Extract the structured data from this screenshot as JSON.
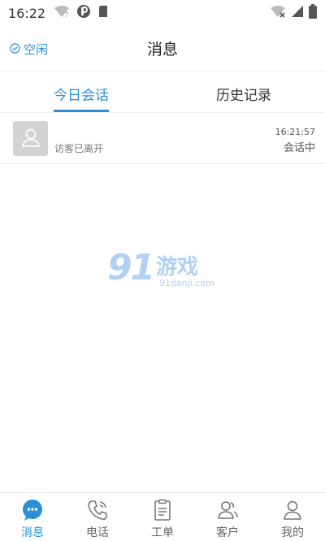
{
  "status_bar": {
    "time": "16:22"
  },
  "header": {
    "status_label": "空闲",
    "title": "消息"
  },
  "tabs": [
    {
      "label": "今日会话"
    },
    {
      "label": "历史记录"
    }
  ],
  "sessions": [
    {
      "message": "访客已离开",
      "time": "16:21:57",
      "state": "会话中"
    }
  ],
  "watermark": {
    "number": "91",
    "brand": "游戏",
    "url": "91danji.com"
  },
  "nav": [
    {
      "label": "消息",
      "icon": "chat-bubble-icon"
    },
    {
      "label": "电话",
      "icon": "phone-icon"
    },
    {
      "label": "工单",
      "icon": "clipboard-icon"
    },
    {
      "label": "客户",
      "icon": "customers-icon"
    },
    {
      "label": "我的",
      "icon": "person-icon"
    }
  ],
  "colors": {
    "accent": "#2b8fd8",
    "watermark": "#a9cdf3"
  }
}
